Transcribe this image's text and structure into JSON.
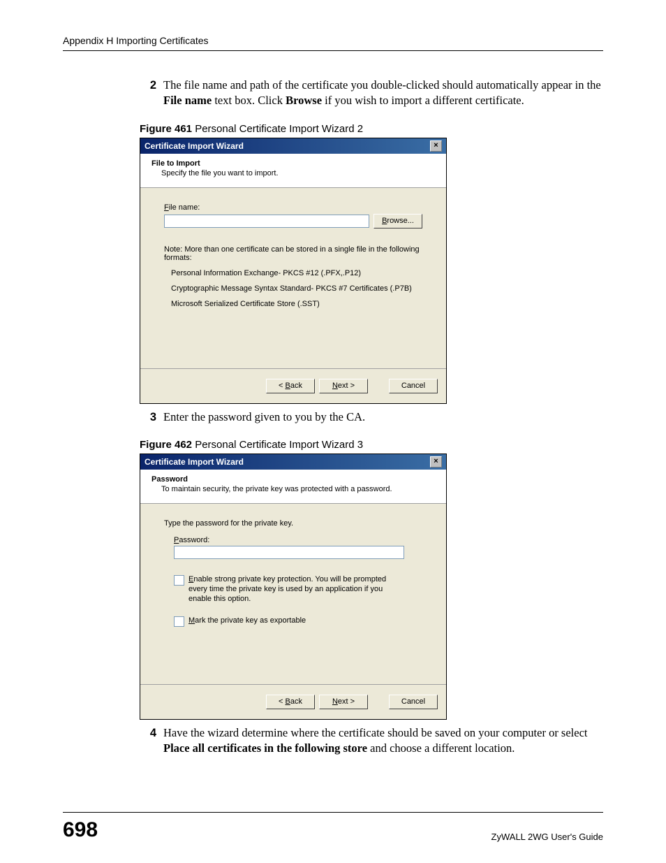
{
  "header": "Appendix H Importing Certificates",
  "steps": {
    "s2_num": "2",
    "s2_a": "The file name and path of the certificate you double-clicked should automatically appear in the ",
    "s2_b": "File name",
    "s2_c": " text box. Click ",
    "s2_d": "Browse",
    "s2_e": " if you wish to import a different certificate.",
    "s3_num": "3",
    "s3": "Enter the password given to you by the CA.",
    "s4_num": "4",
    "s4_a": "Have the wizard determine where the certificate should be saved on your computer or select ",
    "s4_b": "Place all certificates in the following store",
    "s4_c": " and choose a different location."
  },
  "fig461": {
    "caption_b": "Figure 461",
    "caption": "   Personal Certificate Import Wizard 2",
    "title": "Certificate Import Wizard",
    "h1": "File to Import",
    "h2": "Specify the file you want to import.",
    "file_label_pre": "F",
    "file_label_post": "ile name:",
    "browse_pre": "B",
    "browse_post": "rowse...",
    "note": "Note:  More than one certificate can be stored in a single file in the following formats:",
    "fmt1": "Personal Information Exchange- PKCS #12 (.PFX,.P12)",
    "fmt2": "Cryptographic Message Syntax Standard- PKCS #7 Certificates (.P7B)",
    "fmt3": "Microsoft Serialized Certificate Store (.SST)",
    "back_pre": "< ",
    "back_u": "B",
    "back_post": "ack",
    "next_u": "N",
    "next_post": "ext >",
    "cancel": "Cancel"
  },
  "fig462": {
    "caption_b": "Figure 462",
    "caption": "   Personal Certificate Import Wizard 3",
    "title": "Certificate Import Wizard",
    "h1": "Password",
    "h2": "To maintain security, the private key was protected with a password.",
    "typepwd": "Type the password for the private key.",
    "pwd_u": "P",
    "pwd_post": "assword:",
    "chk1_u": "E",
    "chk1_post": "nable strong private key protection. You will be prompted every time the private key is used by an application if you enable this option.",
    "chk2_u": "M",
    "chk2_post": "ark the private key as exportable",
    "back_pre": "< ",
    "back_u": "B",
    "back_post": "ack",
    "next_u": "N",
    "next_post": "ext >",
    "cancel": "Cancel"
  },
  "footer": {
    "page": "698",
    "guide": "ZyWALL 2WG User's Guide"
  }
}
